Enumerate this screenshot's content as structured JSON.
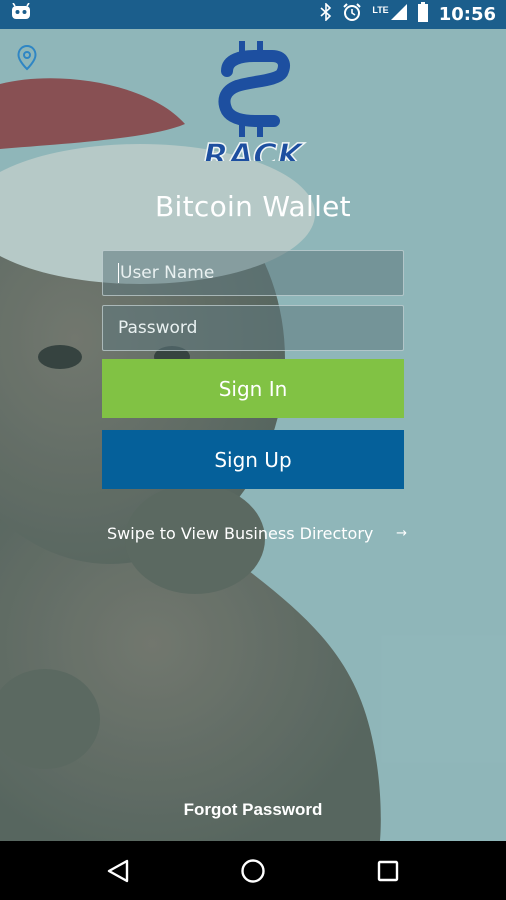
{
  "status_bar": {
    "time": "10:56",
    "network": "LTE",
    "icons": [
      "android-debug-icon",
      "bluetooth-icon",
      "alarm-icon",
      "signal-icon",
      "battery-icon"
    ]
  },
  "header": {
    "logo_text": "RACK",
    "title": "Bitcoin Wallet",
    "location_icon": "location-pin-icon"
  },
  "form": {
    "username_placeholder": "User Name",
    "password_placeholder": "Password",
    "signin_label": "Sign In",
    "signup_label": "Sign Up"
  },
  "swipe": {
    "text": "Swipe to View Business Directory",
    "arrow": "→"
  },
  "forgot_password": "Forgot Password",
  "colors": {
    "status_bar": "#1b5e8c",
    "signin": "#81c244",
    "signup": "#05609a",
    "logo": "#1d4fa0"
  },
  "nav": {
    "icons": [
      "back-icon",
      "home-icon",
      "recents-icon"
    ]
  }
}
